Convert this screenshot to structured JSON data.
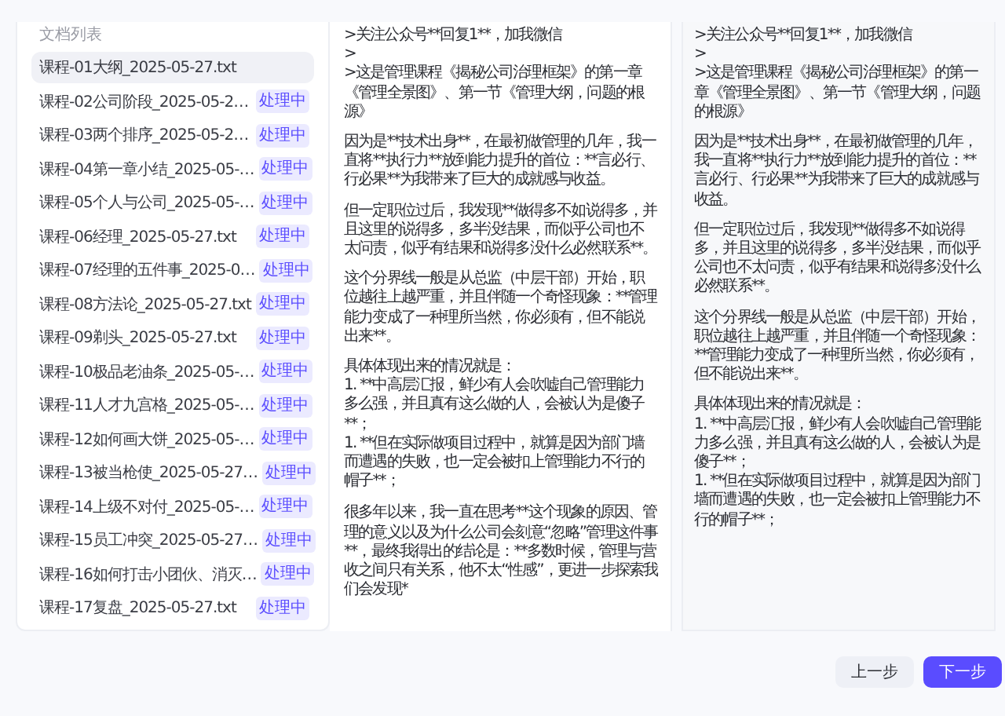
{
  "sidebar": {
    "title": "文档列表",
    "items": [
      {
        "name": "课程-01大纲_2025-05-27.txt",
        "selected": true
      },
      {
        "name": "课程-02公司阶段_2025-05-2…",
        "selected": false,
        "badge": "处理中"
      },
      {
        "name": "课程-03两个排序_2025-05-2…",
        "selected": false,
        "badge": "处理中"
      },
      {
        "name": "课程-04第一章小结_2025-05-…",
        "selected": false,
        "badge": "处理中"
      },
      {
        "name": "课程-05个人与公司_2025-05-…",
        "selected": false,
        "badge": "处理中"
      },
      {
        "name": "课程-06经理_2025-05-27.txt",
        "selected": false,
        "badge": "处理中"
      },
      {
        "name": "课程-07经理的五件事_2025-0…",
        "selected": false,
        "badge": "处理中"
      },
      {
        "name": "课程-08方法论_2025-05-27.txt",
        "selected": false,
        "badge": "处理中"
      },
      {
        "name": "课程-09剃头_2025-05-27.txt",
        "selected": false,
        "badge": "处理中"
      },
      {
        "name": "课程-10极品老油条_2025-05-…",
        "selected": false,
        "badge": "处理中"
      },
      {
        "name": "课程-11人才九宫格_2025-05-…",
        "selected": false,
        "badge": "处理中"
      },
      {
        "name": "课程-12如何画大饼_2025-05-…",
        "selected": false,
        "badge": "处理中"
      },
      {
        "name": "课程-13被当枪使_2025-05-27…",
        "selected": false,
        "badge": "处理中"
      },
      {
        "name": "课程-14上级不对付_2025-05-…",
        "selected": false,
        "badge": "处理中"
      },
      {
        "name": "课程-15员工冲突_2025-05-27…",
        "selected": false,
        "badge": "处理中"
      },
      {
        "name": "课程-16如何打击小团伙、消灭…",
        "selected": false,
        "badge": "处理中"
      },
      {
        "name": "课程-17复盘_2025-05-27.txt",
        "selected": false,
        "badge": "处理中"
      }
    ]
  },
  "source_text": {
    "paragraphs": [
      [
        ">关注公众号**回复1**，加我微信",
        ">",
        ">这是管理课程《揭秘公司治理框架》的第一章《管理全景图》、第一节《管理大纲，问题的根源》"
      ],
      [
        "因为是**技术出身**，在最初做管理的几年，我一直将**执行力**放到能力提升的首位：**言必行、行必果**为我带来了巨大的成就感与收益。"
      ],
      [
        "但一定职位过后，我发现**做得多不如说得多，并且这里的说得多，多半没结果，而似乎公司也不太问责，似乎有结果和说得多没什么必然联系**。"
      ],
      [
        "这个分界线一般是从总监（中层干部）开始，职位越往上越严重，并且伴随一个奇怪现象：**管理能力变成了一种理所当然，你必须有，但不能说出来**。"
      ],
      [
        "具体体现出来的情况就是：",
        "1. **中高层汇报，鲜少有人会吹嘘自己管理能力多么强，并且真有这么做的人，会被认为是傻子**；",
        "1. **但在实际做项目过程中，就算是因为部门墙而遭遇的失败，也一定会被扣上管理能力不行的帽子**；"
      ],
      [
        "很多年以来，我一直在思考**这个现象的原因、管理的意义以及为什么公司会刻意“忽略”管理这件事**，最终我得出的结论是：**多数时候，管理与营收之间只有关系，他不太“性感”，更进一步探索我们会发现*"
      ]
    ]
  },
  "preview_text": {
    "paragraphs": [
      [
        ">关注公众号**回复1**，加我微信",
        ">",
        ">这是管理课程《揭秘公司治理框架》的第一章《管理全景图》、第一节《管理大纲，问题的根源》"
      ],
      [
        "因为是**技术出身**，在最初做管理的几年，我一直将**执行力**放到能力提升的首位：**言必行、行必果**为我带来了巨大的成就感与收益。"
      ],
      [
        "但一定职位过后，我发现**做得多不如说得多，并且这里的说得多，多半没结果，而似乎公司也不太问责，似乎有结果和说得多没什么必然联系**。"
      ],
      [
        "这个分界线一般是从总监（中层干部）开始，职位越往上越严重，并且伴随一个奇怪现象：**管理能力变成了一种理所当然，你必须有，但不能说出来**。"
      ],
      [
        "具体体现出来的情况就是：",
        "1. **中高层汇报，鲜少有人会吹嘘自己管理能力多么强，并且真有这么做的人，会被认为是傻子**；",
        "1. **但在实际做项目过程中，就算是因为部门墙而遭遇的失败，也一定会被扣上管理能力不行的帽子**；"
      ]
    ]
  },
  "buttons": [
    {
      "label": "上一步",
      "kind": "secondary"
    },
    {
      "label": "下一步",
      "kind": "primary"
    }
  ]
}
